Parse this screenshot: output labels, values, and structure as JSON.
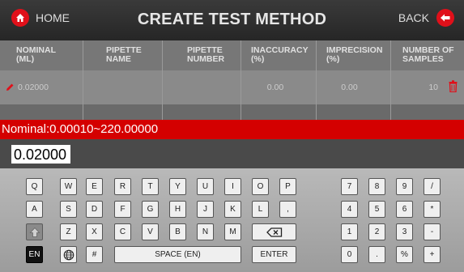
{
  "header": {
    "home_label": "HOME",
    "title": "CREATE TEST METHOD",
    "back_label": "BACK",
    "accent_color": "#e0101a"
  },
  "table": {
    "columns": [
      {
        "line1": "NOMINAL",
        "line2": "(ml)"
      },
      {
        "line1": "PIPETTE",
        "line2": "NAME"
      },
      {
        "line1": "PIPETTE",
        "line2": "NUMBER"
      },
      {
        "line1": "INACCURACY",
        "line2": "(%)"
      },
      {
        "line1": "IMPRECISION",
        "line2": "(%)"
      },
      {
        "line1": "NUMBER OF",
        "line2": "SAMPLES"
      }
    ],
    "rows": [
      {
        "nominal": "0.02000",
        "pipette_name": "",
        "pipette_number": "",
        "inaccuracy": "0.00",
        "imprecision": "0.00",
        "samples": "10",
        "edit_icon": "pencil-icon",
        "delete_icon": "trash-icon"
      }
    ]
  },
  "range_text": "Nominal:0.00010~220.00000",
  "input_value": "0.02000",
  "keyboard": {
    "row1": [
      "Q",
      "W",
      "E",
      "R",
      "T",
      "Y",
      "U",
      "I",
      "O",
      "P"
    ],
    "row2": [
      "A",
      "S",
      "D",
      "F",
      "G",
      "H",
      "J",
      "K",
      "L",
      ","
    ],
    "row3": [
      "Z",
      "X",
      "C",
      "V",
      "B",
      "N",
      "M"
    ],
    "numpad_row1": [
      "7",
      "8",
      "9",
      "/"
    ],
    "numpad_row2": [
      "4",
      "5",
      "6",
      "*"
    ],
    "numpad_row3": [
      "1",
      "2",
      "3",
      "-"
    ],
    "numpad_row4": [
      "0",
      ".",
      "%",
      "+"
    ],
    "lang": "EN",
    "hash": "#",
    "space": "SPACE (EN)",
    "enter": "ENTER",
    "shift_icon": "shift-arrow-icon",
    "backspace_icon": "backspace-icon",
    "globe_icon": "globe-icon"
  }
}
